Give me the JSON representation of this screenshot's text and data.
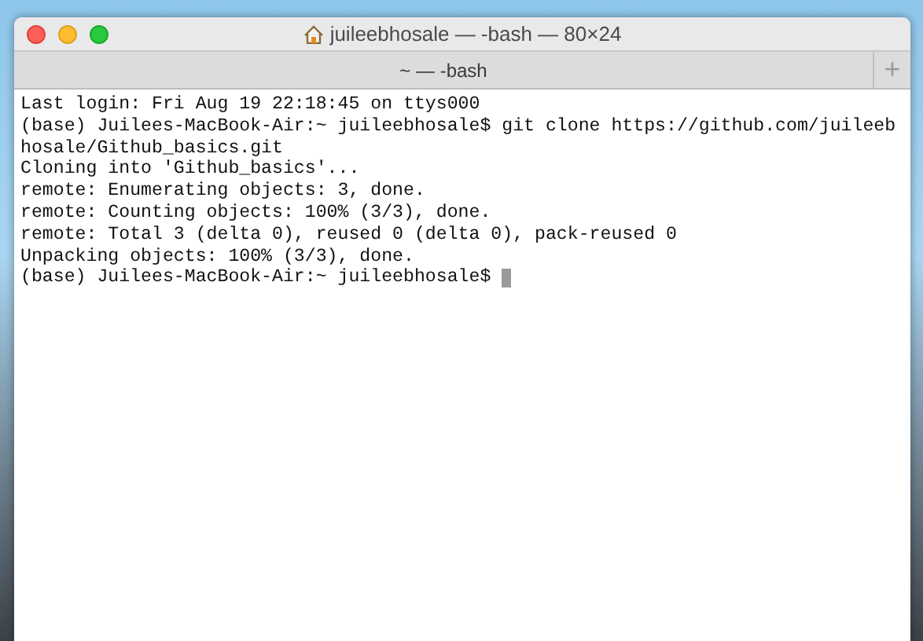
{
  "window": {
    "title": "juileebhosale — -bash — 80×24"
  },
  "tabs": [
    {
      "label": "~ — -bash",
      "selected": true
    }
  ],
  "new_tab_button": "+",
  "terminal": {
    "lines": [
      "Last login: Fri Aug 19 22:18:45 on ttys000",
      "(base) Juilees-MacBook-Air:~ juileebhosale$ git clone https://github.com/juileeb",
      "hosale/Github_basics.git",
      "Cloning into 'Github_basics'...",
      "remote: Enumerating objects: 3, done.",
      "remote: Counting objects: 100% (3/3), done.",
      "remote: Total 3 (delta 0), reused 0 (delta 0), pack-reused 0",
      "Unpacking objects: 100% (3/3), done.",
      "(base) Juilees-MacBook-Air:~ juileebhosale$"
    ]
  }
}
